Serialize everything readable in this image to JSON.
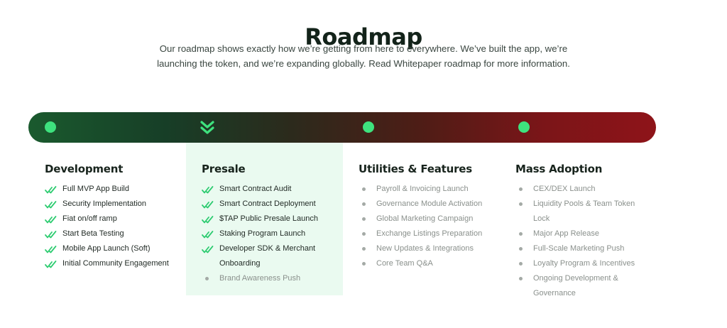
{
  "header": {
    "title": "Roadmap",
    "subtitle": "Our roadmap shows exactly how we’re getting from here to everywhere. We’ve built the app, we’re launching the token, and we’re expanding globally. Read Whitepaper roadmap for more information."
  },
  "colors": {
    "accent": "#3ee27e",
    "check": "#2ecc71",
    "bar_start": "#1a5a2e",
    "bar_end": "#8e1419",
    "active_bg": "#eafaf0"
  },
  "phases": [
    {
      "title": "Development",
      "marker": "dot",
      "active": false,
      "items": [
        {
          "label": "Full MVP App Build",
          "done": true
        },
        {
          "label": "Security Implementation",
          "done": true
        },
        {
          "label": "Fiat on/off ramp",
          "done": true
        },
        {
          "label": "Start Beta Testing",
          "done": true
        },
        {
          "label": "Mobile App Launch (Soft)",
          "done": true
        },
        {
          "label": "Initial Community Engagement",
          "done": true
        }
      ]
    },
    {
      "title": "Presale",
      "marker": "chevron-down-icon",
      "active": true,
      "items": [
        {
          "label": "Smart Contract Audit",
          "done": true
        },
        {
          "label": "Smart Contract Deployment",
          "done": true
        },
        {
          "label": "$TAP Public Presale Launch",
          "done": true
        },
        {
          "label": "Staking Program Launch",
          "done": true
        },
        {
          "label": "Developer SDK & Merchant Onboarding",
          "done": true
        },
        {
          "label": "Brand Awareness Push",
          "done": false
        }
      ]
    },
    {
      "title": "Utilities & Features",
      "marker": "dot",
      "active": false,
      "items": [
        {
          "label": "Payroll & Invoicing Launch",
          "done": false
        },
        {
          "label": "Governance Module Activation",
          "done": false
        },
        {
          "label": "Global Marketing Campaign",
          "done": false
        },
        {
          "label": "Exchange Listings Preparation",
          "done": false
        },
        {
          "label": "New Updates & Integrations",
          "done": false
        },
        {
          "label": "Core Team Q&A",
          "done": false
        }
      ]
    },
    {
      "title": "Mass Adoption",
      "marker": "dot",
      "active": false,
      "items": [
        {
          "label": "CEX/DEX Launch",
          "done": false
        },
        {
          "label": "Liquidity Pools & Team Token Lock",
          "done": false
        },
        {
          "label": "Major App Release",
          "done": false
        },
        {
          "label": "Full-Scale Marketing Push",
          "done": false
        },
        {
          "label": "Loyalty Program & Incentives",
          "done": false
        },
        {
          "label": "Ongoing Development & Governance",
          "done": false
        }
      ]
    }
  ]
}
